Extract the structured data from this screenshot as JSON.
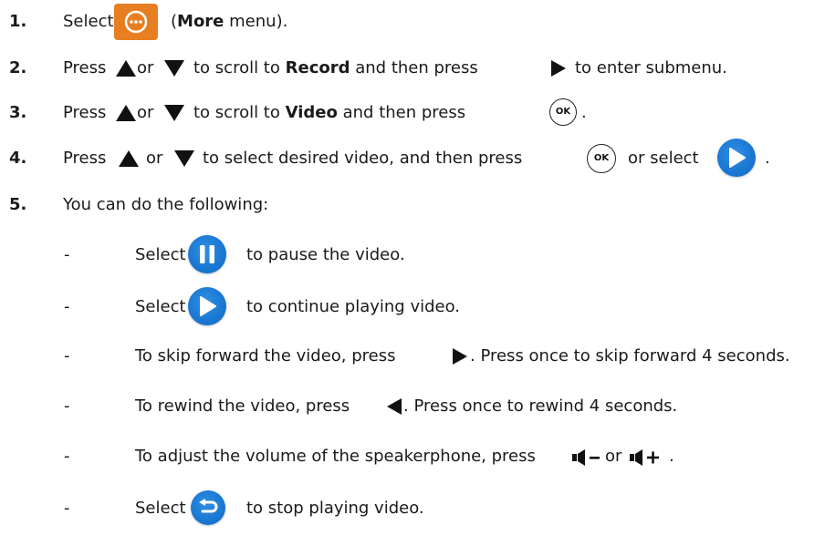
{
  "steps": [
    {
      "number": "1.",
      "text_a": "Select",
      "text_b": "(",
      "bold": "More",
      "text_c": "menu)."
    },
    {
      "number": "2.",
      "text_a": "Press",
      "text_b": "or",
      "text_c": "to scroll to",
      "bold": "Record",
      "text_d": "and then press",
      "text_e": "to enter submenu."
    },
    {
      "number": "3.",
      "text_a": "Press",
      "text_b": "or",
      "text_c": "to scroll to",
      "bold": "Video",
      "text_d": "and then press",
      "text_e": "."
    },
    {
      "number": "4.",
      "text_a": "Press",
      "text_b": "or",
      "text_c": "to select desired video, and then press",
      "text_d": "or select",
      "text_e": "."
    },
    {
      "number": "5.",
      "text_a": "You can do the following:"
    }
  ],
  "ok_label": "OK",
  "bullets": [
    {
      "dash": "-",
      "text_a": "Select",
      "text_b": "to pause the video."
    },
    {
      "dash": "-",
      "text_a": "Select",
      "text_b": "to continue playing video."
    },
    {
      "dash": "-",
      "text_a": "To skip forward the video, press",
      "text_b": ". Press once to skip forward 4 seconds."
    },
    {
      "dash": "-",
      "text_a": "To rewind the video, press",
      "text_b": ". Press once to rewind 4 seconds."
    },
    {
      "dash": "-",
      "text_a": "To adjust the volume of the speakerphone, press",
      "text_b": "or",
      "text_c": "."
    },
    {
      "dash": "-",
      "text_a": "Select",
      "text_b": "to stop playing video."
    }
  ],
  "colors": {
    "more_orange": "#e77f22",
    "blue": "#1673cf",
    "text": "#1a1a1a"
  }
}
